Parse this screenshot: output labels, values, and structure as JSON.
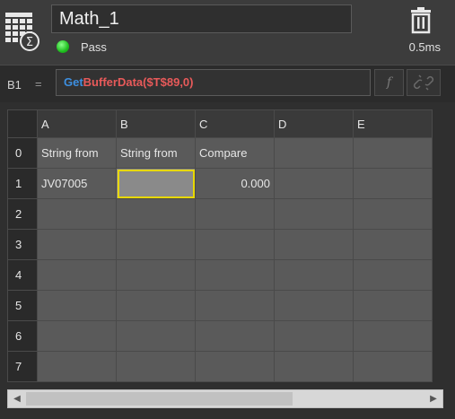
{
  "tool": {
    "name": "Math_1",
    "status": "Pass",
    "time": "0.5ms",
    "status_color": "#2ecc2e"
  },
  "formula_bar": {
    "cell_ref": "B1",
    "equals": "=",
    "formula_fn": "Get",
    "formula_rest": "BufferData($T$89,0)",
    "fx_label": "f"
  },
  "grid": {
    "columns": [
      "A",
      "B",
      "C",
      "D",
      "E"
    ],
    "rows": [
      {
        "index": "0",
        "cells": [
          "String from",
          "String from",
          "Compare",
          "",
          ""
        ]
      },
      {
        "index": "1",
        "cells": [
          "JV07005",
          "",
          "0.000",
          "",
          ""
        ]
      },
      {
        "index": "2",
        "cells": [
          "",
          "",
          "",
          "",
          ""
        ]
      },
      {
        "index": "3",
        "cells": [
          "",
          "",
          "",
          "",
          ""
        ]
      },
      {
        "index": "4",
        "cells": [
          "",
          "",
          "",
          "",
          ""
        ]
      },
      {
        "index": "5",
        "cells": [
          "",
          "",
          "",
          "",
          ""
        ]
      },
      {
        "index": "6",
        "cells": [
          "",
          "",
          "",
          "",
          ""
        ]
      },
      {
        "index": "7",
        "cells": [
          "",
          "",
          "",
          "",
          ""
        ]
      }
    ],
    "selected_cell": "B1"
  },
  "scrollbar": {
    "left_arrow": "◀",
    "right_arrow": "▶"
  }
}
